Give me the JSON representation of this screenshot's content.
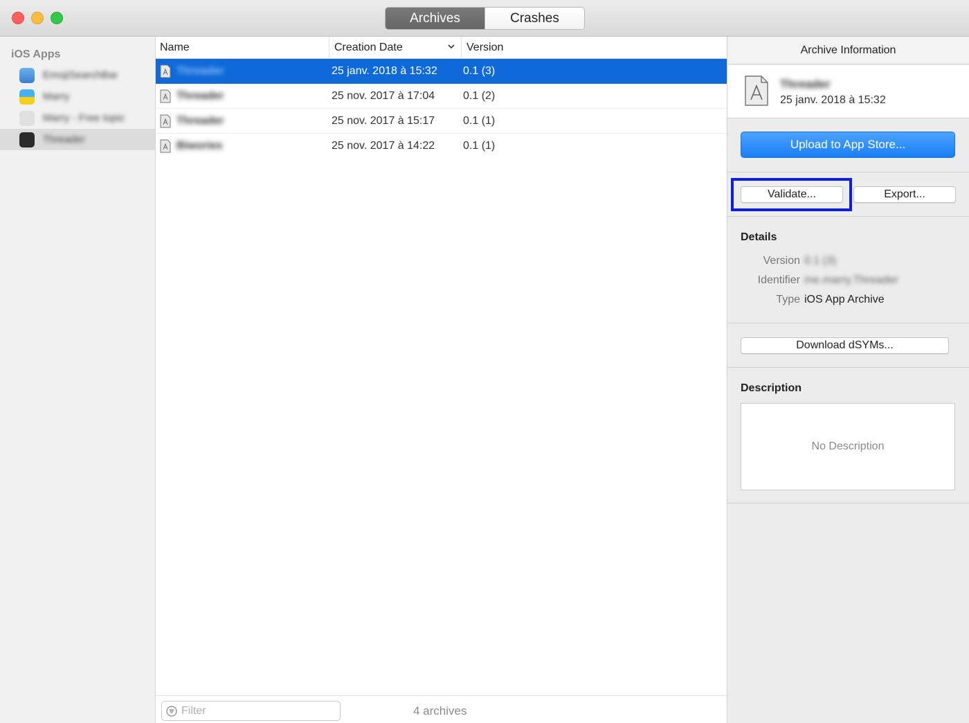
{
  "titlebar": {
    "tabs": [
      {
        "label": "Archives",
        "active": true
      },
      {
        "label": "Crashes",
        "active": false
      }
    ]
  },
  "sidebar": {
    "heading": "iOS Apps",
    "apps": [
      {
        "name": "EmojiSearchBar",
        "icon_color": "#4a8fd8"
      },
      {
        "name": "Marry",
        "icon_color": "#f2c418"
      },
      {
        "name": "Marry - Free topic",
        "icon_color": "#d8d8d8"
      },
      {
        "name": "Threader",
        "icon_color": "#2b2b2b",
        "selected": true
      }
    ]
  },
  "list": {
    "columns": [
      "Name",
      "Creation Date",
      "Version"
    ],
    "rows": [
      {
        "name": "Threader",
        "date": "25 janv. 2018 à 15:32",
        "version": "0.1 (3)",
        "selected": true
      },
      {
        "name": "Threader",
        "date": "25 nov. 2017 à 17:04",
        "version": "0.1 (2)"
      },
      {
        "name": "Threader",
        "date": "25 nov. 2017 à 15:17",
        "version": "0.1 (1)"
      },
      {
        "name": "Biwories",
        "date": "25 nov. 2017 à 14:22",
        "version": "0.1 (1)"
      }
    ],
    "filter_placeholder": "Filter",
    "count_label": "4 archives"
  },
  "inspector": {
    "title": "Archive Information",
    "archive_name": "Threader",
    "archive_date": "25 janv. 2018 à 15:32",
    "upload_label": "Upload to App Store...",
    "validate_label": "Validate...",
    "export_label": "Export...",
    "details_title": "Details",
    "details": [
      {
        "key": "Version",
        "value": "0.1 (3)",
        "blurred": true
      },
      {
        "key": "Identifier",
        "value": "me.marry.Threader",
        "blurred": true
      },
      {
        "key": "Type",
        "value": "iOS App Archive",
        "blurred": false
      }
    ],
    "dsym_label": "Download dSYMs...",
    "description_title": "Description",
    "description_placeholder": "No Description"
  },
  "colors": {
    "selection": "#0f69d8",
    "upload_button": "#1a7ff4",
    "highlight": "#0b1cf0"
  }
}
